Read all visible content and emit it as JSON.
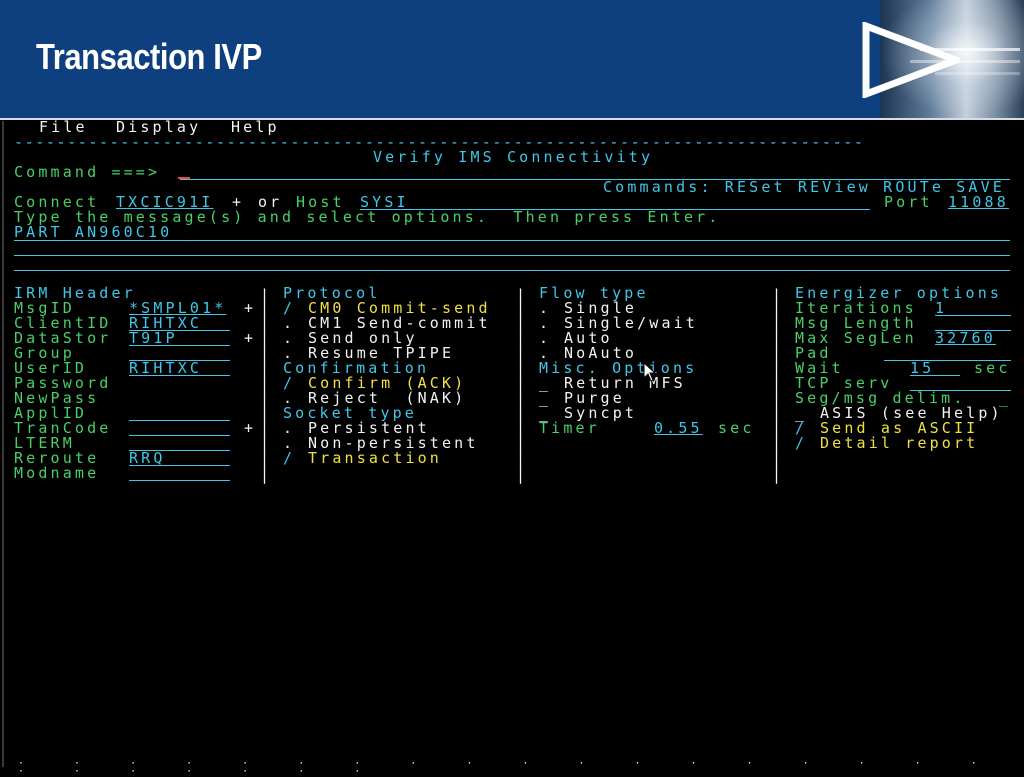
{
  "slide": {
    "title": "Transaction IVP"
  },
  "menu": {
    "file": "File",
    "display": "Display",
    "help": "Help"
  },
  "dash_line": "--------------------------------------------------------------------------------",
  "panel_title": "Verify IMS Connectivity",
  "command": {
    "label": "Command ===>",
    "value": ""
  },
  "commands_line": "Commands: RESet REView ROUTe SAVE",
  "connect": {
    "label": "Connect",
    "value": "TXCIC91I",
    "plus": "+",
    "or": "or",
    "host_label": "Host",
    "host_value": "SYSI",
    "port_label": "Port",
    "port_value": "11088"
  },
  "instruction": "Type the message(s) and select options.  Then press Enter.",
  "message_line1": "PART AN960C10",
  "irm": {
    "heading": "IRM Header",
    "msgid_label": "MsgID",
    "msgid_value": "*SMPL01*",
    "clientid_label": "ClientID",
    "clientid_value": "RIHTXC",
    "datastor_label": "DataStor",
    "datastor_value": "T91P",
    "group_label": "Group",
    "group_value": "",
    "userid_label": "UserID",
    "userid_value": "RIHTXC",
    "password_label": "Password",
    "newpass_label": "NewPass",
    "applid_label": "ApplID",
    "applid_value": "",
    "trancode_label": "TranCode",
    "trancode_value": "",
    "lterm_label": "LTERM",
    "lterm_value": "",
    "reroute_label": "Reroute",
    "reroute_value": "RRQ",
    "modname_label": "Modname",
    "modname_value": "",
    "plus": "+"
  },
  "protocol": {
    "heading": "Protocol",
    "cm0_mark": "/",
    "cm0_label": "CM0 Commit-send",
    "cm1_mark": ".",
    "cm1_label": "CM1 Send-commit",
    "send_only_mark": ".",
    "send_only_label": "Send only",
    "resume_mark": ".",
    "resume_label": "Resume TPIPE",
    "confirmation_heading": "Confirmation",
    "confirm_mark": "/",
    "confirm_label": "Confirm (ACK)",
    "reject_mark": ".",
    "reject_label": "Reject  (NAK)",
    "socket_heading": "Socket type",
    "persistent_mark": ".",
    "persistent_label": "Persistent",
    "nonpersistent_mark": ".",
    "nonpersistent_label": "Non-persistent",
    "transaction_mark": "/",
    "transaction_label": "Transaction"
  },
  "flow": {
    "heading": "Flow type",
    "single_mark": ".",
    "single_label": "Single",
    "singlewait_mark": ".",
    "singlewait_label": "Single/wait",
    "auto_mark": ".",
    "auto_label": "Auto",
    "noauto_mark": ".",
    "noauto_label": "NoAuto",
    "misc_heading": "Misc. Options",
    "return_mark": "_",
    "return_label": "Return MFS",
    "purge_mark": "_",
    "purge_label": "Purge",
    "syncpt_mark": "_",
    "syncpt_label": "Syncpt",
    "timer_label": "Timer",
    "timer_value": "0.55",
    "timer_unit": "sec"
  },
  "energizer": {
    "heading": "Energizer options",
    "iterations_label": "Iterations",
    "iterations_value": "1",
    "msglength_label": "Msg Length",
    "msglength_value": "",
    "maxseglen_label": "Max SegLen",
    "maxseglen_value": "32760",
    "pad_label": "Pad",
    "pad_value": "",
    "wait_label": "Wait",
    "wait_value": "15",
    "wait_unit": "sec",
    "tcpserv_label": "TCP serv",
    "tcpserv_value": "",
    "segmsg_label": "Seg/msg delim.",
    "segmsg_value": "_",
    "asis_mark": "_",
    "asis_label": "ASIS (see Help)",
    "ascii_mark": "/",
    "ascii_label": "Send as ASCII",
    "detail_mark": "/",
    "detail_label": "Detail report"
  },
  "colors": {
    "header_bg": "#0e3f7f",
    "terminal_bg": "#000000",
    "cyan": "#3fc6e8",
    "green": "#47d068",
    "yellow": "#f0e040",
    "white": "#f2f2f2"
  }
}
